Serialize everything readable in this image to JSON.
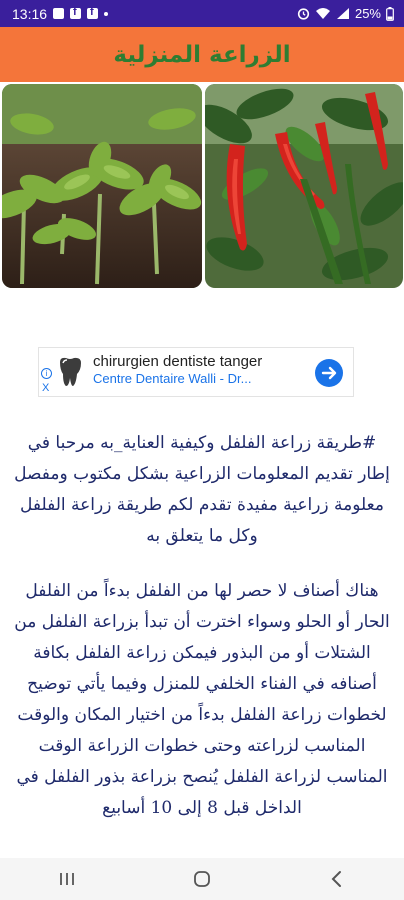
{
  "status_bar": {
    "time": "13:16",
    "battery": "25%",
    "left_icons": [
      "gallery-icon",
      "facebook-icon",
      "facebook-icon",
      "notification-dot-icon"
    ],
    "right_icons": [
      "alarm-icon",
      "wifi-icon",
      "signal-icon",
      "battery-icon"
    ]
  },
  "app_bar": {
    "title": "الزراعة المنزلية",
    "title_color": "#2e7d32",
    "background": "#f4753a"
  },
  "hero": {
    "left_image": "pepper-seedlings-image",
    "right_image": "red-chili-peppers-image"
  },
  "ad": {
    "title": "chirurgien dentiste tanger",
    "subtitle": "Centre Dentaire Walli - Dr...",
    "info_label": "i",
    "close_label": "X"
  },
  "article": {
    "paragraph1": "#طريقة زراعة الفلفل وكيفية العناية_به مرحبا في إطار تقديم المعلومات الزراعية بشكل مكتوب ومفصل معلومة زراعية مفيدة تقدم لكم طريقة زراعة الفلفل وكل ما يتعلق به",
    "paragraph2": "هناك أصناف لا حصر لها من الفلفل بدءاً من الفلفل الحار أو الحلو وسواء اخترت أن تبدأ بزراعة الفلفل من الشتلات أو من البذور فيمكن زراعة الفلفل بكافة أصنافه في الفناء الخلفي للمنزل وفيما يأتي توضيح لخطوات زراعة الفلفل بدءاً من اختيار المكان والوقت المناسب لزراعته وحتى خطوات الزراعة الوقت المناسب لزراعة الفلفل يُنصح بزراعة بذور الفلفل في الداخل قبل 8 إلى 10 أسابيع"
  },
  "nav_bar": {
    "buttons": [
      "recents-icon",
      "home-icon",
      "back-icon"
    ]
  }
}
